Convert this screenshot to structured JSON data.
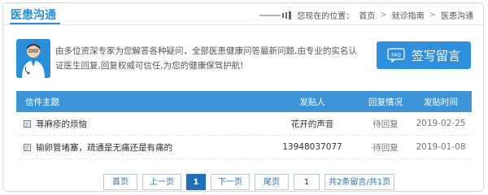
{
  "header": {
    "title": "医患沟通",
    "location_label": "您现在的位置：",
    "breadcrumb": [
      "首页",
      "就诊指南",
      "医患沟通"
    ],
    "separator": ">"
  },
  "intro": {
    "text": "由多位资深专家为您解答各种疑问，全部医患健康问答最新问题,由专业的实名认证医生回复,回复权威可信任,为您的健康保驾护航!",
    "write_button": "签写留言",
    "faq_badge": "FAQ"
  },
  "table": {
    "headers": {
      "subject": "信件主题",
      "poster": "发贴人",
      "status": "回复情况",
      "time": "发贴时间"
    },
    "rows": [
      {
        "subject": "荨麻疹的烦恼",
        "poster": "花开的声音",
        "status": "待回复",
        "time": "2019-02-25"
      },
      {
        "subject": "输卵管堵塞，疏通是无痛还是有痛的",
        "poster": "13948037077",
        "status": "待回复",
        "time": "2019-01-08"
      }
    ]
  },
  "pager": {
    "first": "首页",
    "prev": "上一页",
    "current": "1",
    "next": "下一页",
    "last": "尾页",
    "jump_value": "1",
    "summary": "共2条留言/共1页"
  },
  "colors": {
    "accent": "#2f8fdc",
    "header_bar": "#3d95d8",
    "active_page": "#1f70b8"
  }
}
